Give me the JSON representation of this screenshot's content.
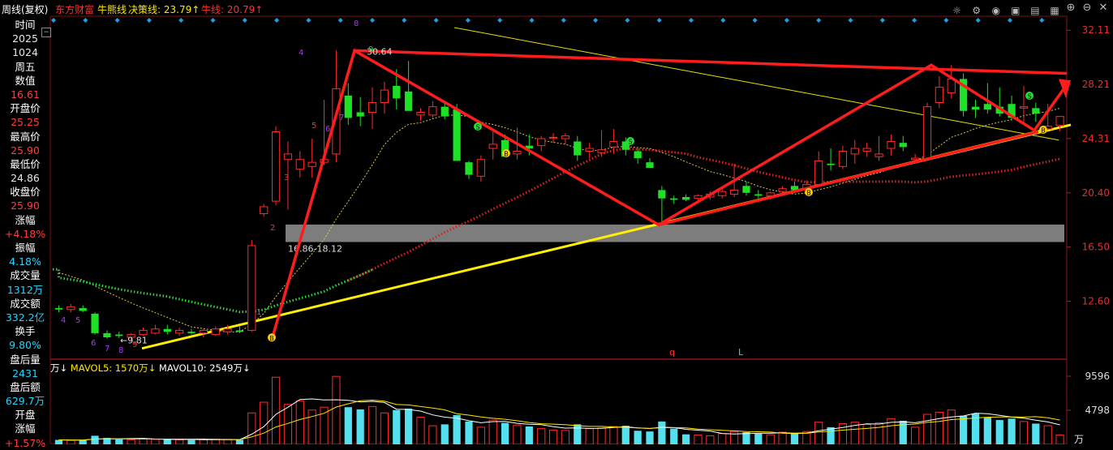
{
  "header": {
    "period": "周线(复权)",
    "stock": "东方财富",
    "line1": "牛熊线",
    "line2": "决策线: 23.79↑",
    "line3": "牛线: 20.79↑",
    "icons": [
      "settings-icon",
      "gear-icon",
      "eye-icon",
      "camera-icon",
      "chart-icon",
      "grid-icon",
      "add-icon",
      "minus-icon"
    ]
  },
  "info_panel": {
    "time_label": "时间",
    "year": "2025",
    "date": "1024",
    "weekday": "周五",
    "value_label": "数值",
    "value": "16.61",
    "open_label": "开盘价",
    "open": "25.25",
    "high_label": "最高价",
    "high": "25.90",
    "low_label": "最低价",
    "low": "24.86",
    "close_label": "收盘价",
    "close": "25.90",
    "chg_label": "涨幅",
    "chg": "+4.18%",
    "amp_label": "振幅",
    "amp": "4.18%",
    "vol_label": "成交量",
    "vol": "1312万",
    "amt_label": "成交额",
    "amt": "332.2亿",
    "turn_label": "换手",
    "turn": "9.80%",
    "after_vol_label": "盘后量",
    "after_vol": "2431",
    "after_amt_label": "盘后额",
    "after_amt": "629.7万",
    "open_chg_label1": "开盘",
    "open_chg_label2": "涨幅",
    "open_chg": "+1.57%"
  },
  "volume_header": {
    "vol_label": "万↓",
    "mavol5": "MAVOL5: 1570万↓",
    "mavol10": "MAVOL10: 2549万↓"
  },
  "price_axis": [
    "32.11",
    "28.21",
    "24.31",
    "20.40",
    "16.50",
    "12.60"
  ],
  "volume_axis": [
    "9596",
    "4798",
    "万"
  ],
  "annotations": {
    "high_label": "30.64",
    "low_label": "9.81",
    "zone_label": "16.86-18.12",
    "marker_q": "q",
    "marker_L": "L"
  },
  "chart_data": {
    "type": "candlestick",
    "title": "",
    "ylim": [
      8.6,
      33.0
    ],
    "candles": [
      {
        "o": 12.1,
        "h": 12.3,
        "l": 11.8,
        "c": 12.0
      },
      {
        "o": 12.0,
        "h": 12.4,
        "l": 11.8,
        "c": 12.2
      },
      {
        "o": 12.1,
        "h": 12.3,
        "l": 11.8,
        "c": 11.9
      },
      {
        "o": 11.7,
        "h": 11.8,
        "l": 10.2,
        "c": 10.3
      },
      {
        "o": 10.3,
        "h": 10.5,
        "l": 9.9,
        "c": 10.0
      },
      {
        "o": 10.2,
        "h": 10.4,
        "l": 9.95,
        "c": 10.1
      },
      {
        "o": 10.0,
        "h": 10.3,
        "l": 9.81,
        "c": 10.2
      },
      {
        "o": 10.2,
        "h": 10.7,
        "l": 10.1,
        "c": 10.5
      },
      {
        "o": 10.3,
        "h": 10.9,
        "l": 10.2,
        "c": 10.6
      },
      {
        "o": 10.6,
        "h": 10.9,
        "l": 10.2,
        "c": 10.4
      },
      {
        "o": 10.3,
        "h": 10.7,
        "l": 10.1,
        "c": 10.5
      },
      {
        "o": 10.4,
        "h": 10.6,
        "l": 10.2,
        "c": 10.3
      },
      {
        "o": 10.3,
        "h": 10.6,
        "l": 10.0,
        "c": 10.5
      },
      {
        "o": 10.2,
        "h": 10.8,
        "l": 10.1,
        "c": 10.6
      },
      {
        "o": 10.4,
        "h": 10.9,
        "l": 10.2,
        "c": 10.6
      },
      {
        "o": 10.5,
        "h": 10.8,
        "l": 10.3,
        "c": 10.4
      },
      {
        "o": 10.5,
        "h": 17.0,
        "l": 10.4,
        "c": 16.6
      },
      {
        "o": 18.9,
        "h": 19.6,
        "l": 18.7,
        "c": 19.4
      },
      {
        "o": 19.8,
        "h": 25.2,
        "l": 19.5,
        "c": 24.8
      },
      {
        "o": 22.8,
        "h": 24.1,
        "l": 19.2,
        "c": 23.2
      },
      {
        "o": 22.1,
        "h": 23.4,
        "l": 21.5,
        "c": 22.8
      },
      {
        "o": 22.3,
        "h": 24.3,
        "l": 21.5,
        "c": 22.6
      },
      {
        "o": 22.6,
        "h": 27.1,
        "l": 22.4,
        "c": 22.8
      },
      {
        "o": 23.2,
        "h": 30.64,
        "l": 22.6,
        "c": 27.9
      },
      {
        "o": 27.4,
        "h": 28.3,
        "l": 25.3,
        "c": 25.8
      },
      {
        "o": 26.2,
        "h": 27.3,
        "l": 25.2,
        "c": 25.9
      },
      {
        "o": 26.2,
        "h": 28.0,
        "l": 25.0,
        "c": 26.9
      },
      {
        "o": 26.9,
        "h": 28.4,
        "l": 26.1,
        "c": 27.8
      },
      {
        "o": 28.1,
        "h": 29.3,
        "l": 26.4,
        "c": 27.2
      },
      {
        "o": 27.7,
        "h": 29.9,
        "l": 26.8,
        "c": 26.3
      },
      {
        "o": 26.0,
        "h": 26.5,
        "l": 25.6,
        "c": 26.2
      },
      {
        "o": 26.0,
        "h": 27.0,
        "l": 25.8,
        "c": 26.6
      },
      {
        "o": 26.6,
        "h": 26.9,
        "l": 25.7,
        "c": 25.9
      },
      {
        "o": 26.4,
        "h": 26.8,
        "l": 25.2,
        "c": 22.7
      },
      {
        "o": 22.6,
        "h": 22.7,
        "l": 21.4,
        "c": 21.7
      },
      {
        "o": 21.6,
        "h": 23.1,
        "l": 21.2,
        "c": 22.8
      },
      {
        "o": 23.6,
        "h": 24.8,
        "l": 22.8,
        "c": 23.9
      },
      {
        "o": 24.2,
        "h": 24.6,
        "l": 23.1,
        "c": 23.0
      },
      {
        "o": 23.2,
        "h": 25.1,
        "l": 22.8,
        "c": 23.4
      },
      {
        "o": 23.8,
        "h": 24.6,
        "l": 23.1,
        "c": 23.6
      },
      {
        "o": 23.8,
        "h": 24.5,
        "l": 23.4,
        "c": 24.3
      },
      {
        "o": 24.4,
        "h": 24.7,
        "l": 24.0,
        "c": 24.4
      },
      {
        "o": 24.3,
        "h": 24.7,
        "l": 23.9,
        "c": 24.5
      },
      {
        "o": 24.1,
        "h": 24.5,
        "l": 22.7,
        "c": 23.1
      },
      {
        "o": 23.4,
        "h": 24.0,
        "l": 22.9,
        "c": 23.6
      },
      {
        "o": 23.3,
        "h": 24.9,
        "l": 23.0,
        "c": 23.5
      },
      {
        "o": 23.7,
        "h": 25.0,
        "l": 23.2,
        "c": 24.1
      },
      {
        "o": 24.1,
        "h": 24.4,
        "l": 23.1,
        "c": 23.5
      },
      {
        "o": 23.4,
        "h": 23.6,
        "l": 22.5,
        "c": 22.9
      },
      {
        "o": 22.6,
        "h": 22.9,
        "l": 22.4,
        "c": 22.2
      },
      {
        "o": 20.6,
        "h": 20.9,
        "l": 18.2,
        "c": 20.0
      },
      {
        "o": 20.0,
        "h": 20.2,
        "l": 19.6,
        "c": 19.9
      },
      {
        "o": 20.1,
        "h": 20.3,
        "l": 19.8,
        "c": 19.9
      },
      {
        "o": 20.0,
        "h": 20.3,
        "l": 19.8,
        "c": 20.2
      },
      {
        "o": 20.1,
        "h": 20.5,
        "l": 19.9,
        "c": 20.3
      },
      {
        "o": 20.2,
        "h": 20.7,
        "l": 20.0,
        "c": 20.5
      },
      {
        "o": 20.3,
        "h": 22.5,
        "l": 20.1,
        "c": 20.6
      },
      {
        "o": 20.9,
        "h": 21.2,
        "l": 20.2,
        "c": 20.4
      },
      {
        "o": 20.3,
        "h": 20.6,
        "l": 20.0,
        "c": 20.2
      },
      {
        "o": 20.2,
        "h": 20.5,
        "l": 19.9,
        "c": 20.4
      },
      {
        "o": 20.5,
        "h": 20.9,
        "l": 20.2,
        "c": 20.7
      },
      {
        "o": 20.9,
        "h": 21.2,
        "l": 20.4,
        "c": 20.6
      },
      {
        "o": 20.6,
        "h": 21.3,
        "l": 20.3,
        "c": 21.0
      },
      {
        "o": 21.0,
        "h": 23.4,
        "l": 20.9,
        "c": 22.7
      },
      {
        "o": 22.5,
        "h": 23.6,
        "l": 22.0,
        "c": 22.4
      },
      {
        "o": 22.3,
        "h": 23.8,
        "l": 22.1,
        "c": 23.4
      },
      {
        "o": 23.2,
        "h": 24.2,
        "l": 22.5,
        "c": 23.6
      },
      {
        "o": 23.4,
        "h": 24.0,
        "l": 23.0,
        "c": 23.6
      },
      {
        "o": 23.0,
        "h": 24.5,
        "l": 22.7,
        "c": 23.2
      },
      {
        "o": 23.6,
        "h": 24.6,
        "l": 23.1,
        "c": 24.1
      },
      {
        "o": 24.0,
        "h": 24.5,
        "l": 23.4,
        "c": 23.7
      },
      {
        "o": 22.8,
        "h": 23.2,
        "l": 22.6,
        "c": 22.9
      },
      {
        "o": 22.8,
        "h": 26.9,
        "l": 22.7,
        "c": 26.6
      },
      {
        "o": 26.9,
        "h": 28.8,
        "l": 26.5,
        "c": 28.0
      },
      {
        "o": 27.6,
        "h": 29.6,
        "l": 27.2,
        "c": 28.6
      },
      {
        "o": 28.6,
        "h": 29.0,
        "l": 25.9,
        "c": 26.3
      },
      {
        "o": 26.6,
        "h": 27.1,
        "l": 25.8,
        "c": 26.4
      },
      {
        "o": 26.8,
        "h": 28.3,
        "l": 26.1,
        "c": 26.4
      },
      {
        "o": 26.6,
        "h": 28.0,
        "l": 25.9,
        "c": 26.1
      },
      {
        "o": 26.8,
        "h": 27.4,
        "l": 25.6,
        "c": 25.8
      },
      {
        "o": 26.5,
        "h": 28.1,
        "l": 25.5,
        "c": 26.6
      },
      {
        "o": 26.5,
        "h": 26.9,
        "l": 25.5,
        "c": 26.1
      },
      {
        "o": 25.0,
        "h": 26.8,
        "l": 24.9,
        "c": 25.2
      },
      {
        "o": 25.25,
        "h": 25.9,
        "l": 24.86,
        "c": 25.9
      }
    ],
    "volume": [
      620,
      560,
      580,
      1200,
      900,
      700,
      650,
      760,
      700,
      680,
      640,
      600,
      660,
      720,
      700,
      640,
      4400,
      5900,
      9400,
      5600,
      6100,
      4800,
      5200,
      9520,
      5200,
      4900,
      5300,
      4400,
      4800,
      5000,
      3800,
      2600,
      2800,
      4100,
      3200,
      2400,
      3400,
      3000,
      2700,
      2500,
      2200,
      2000,
      1950,
      2800,
      2200,
      2300,
      2500,
      2600,
      1900,
      1800,
      3200,
      2200,
      1400,
      1300,
      1200,
      1500,
      1800,
      1700,
      1500,
      1350,
      1700,
      1600,
      1800,
      3100,
      2400,
      2900,
      3100,
      2800,
      3000,
      3600,
      3300,
      2400,
      4200,
      4500,
      4800,
      4000,
      4300,
      3800,
      3400,
      3600,
      3200,
      2900,
      2600,
      1312
    ]
  }
}
